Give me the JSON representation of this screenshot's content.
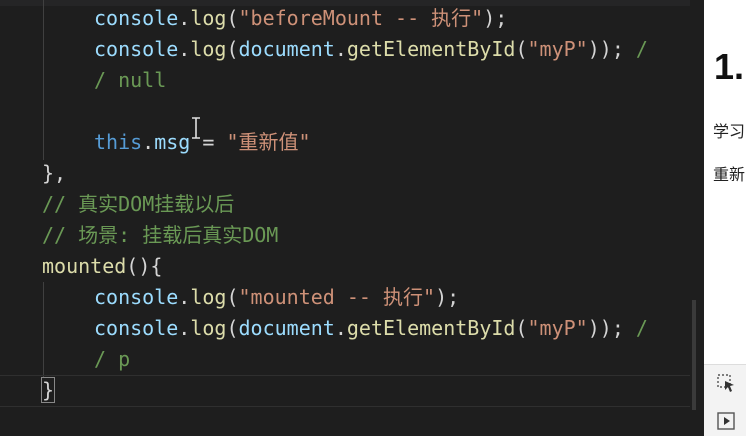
{
  "editor": {
    "lines": [
      {
        "indent": "    ",
        "tokens": [
          {
            "t": "console",
            "c": "var"
          },
          {
            "t": ".",
            "c": "brace"
          },
          {
            "t": "log",
            "c": "fn"
          },
          {
            "t": "(",
            "c": "brace"
          },
          {
            "t": "\"beforeMount -- 执行\"",
            "c": "str"
          },
          {
            "t": ");",
            "c": "brace"
          }
        ]
      },
      {
        "indent": "    ",
        "tokens": [
          {
            "t": "console",
            "c": "var"
          },
          {
            "t": ".",
            "c": "brace"
          },
          {
            "t": "log",
            "c": "fn"
          },
          {
            "t": "(",
            "c": "brace"
          },
          {
            "t": "document",
            "c": "var"
          },
          {
            "t": ".",
            "c": "brace"
          },
          {
            "t": "getElementById",
            "c": "fn"
          },
          {
            "t": "(",
            "c": "brace"
          },
          {
            "t": "\"myP\"",
            "c": "str"
          },
          {
            "t": ")); ",
            "c": "brace"
          },
          {
            "t": "/",
            "c": "cmt"
          }
        ]
      },
      {
        "indent": "    ",
        "tokens": [
          {
            "t": "/ null",
            "c": "cmt"
          }
        ]
      },
      {
        "indent": "",
        "tokens": []
      },
      {
        "indent": "    ",
        "tokens": [
          {
            "t": "this",
            "c": "kw"
          },
          {
            "t": ".",
            "c": "brace"
          },
          {
            "t": "msg",
            "c": "var"
          },
          {
            "t": " = ",
            "c": "brace"
          },
          {
            "t": "\"重新值\"",
            "c": "str"
          }
        ]
      },
      {
        "indent": "",
        "tokens": [
          {
            "t": "},",
            "c": "brace"
          }
        ]
      },
      {
        "indent": "",
        "tokens": [
          {
            "t": "// 真实DOM挂载以后",
            "c": "cmt"
          }
        ]
      },
      {
        "indent": "",
        "tokens": [
          {
            "t": "// 场景: 挂载后真实DOM",
            "c": "cmt"
          }
        ]
      },
      {
        "indent": "",
        "tokens": [
          {
            "t": "mounted",
            "c": "fn"
          },
          {
            "t": "()",
            "c": "brace"
          },
          {
            "t": "{",
            "c": "brace"
          }
        ]
      },
      {
        "indent": "    ",
        "tokens": [
          {
            "t": "console",
            "c": "var"
          },
          {
            "t": ".",
            "c": "brace"
          },
          {
            "t": "log",
            "c": "fn"
          },
          {
            "t": "(",
            "c": "brace"
          },
          {
            "t": "\"mounted -- 执行\"",
            "c": "str"
          },
          {
            "t": ");",
            "c": "brace"
          }
        ]
      },
      {
        "indent": "    ",
        "tokens": [
          {
            "t": "console",
            "c": "var"
          },
          {
            "t": ".",
            "c": "brace"
          },
          {
            "t": "log",
            "c": "fn"
          },
          {
            "t": "(",
            "c": "brace"
          },
          {
            "t": "document",
            "c": "var"
          },
          {
            "t": ".",
            "c": "brace"
          },
          {
            "t": "getElementById",
            "c": "fn"
          },
          {
            "t": "(",
            "c": "brace"
          },
          {
            "t": "\"myP\"",
            "c": "str"
          },
          {
            "t": ")); ",
            "c": "brace"
          },
          {
            "t": "/",
            "c": "cmt"
          }
        ]
      },
      {
        "indent": "    ",
        "tokens": [
          {
            "t": "/ p",
            "c": "cmt"
          }
        ]
      },
      {
        "indent": "",
        "tokens": [
          {
            "t": "}",
            "c": "brace"
          }
        ]
      }
    ]
  },
  "preview": {
    "heading": "1.",
    "text_1": "学习",
    "text_2": "重新"
  },
  "icons": {
    "cursor": "mouse-ibeam-icon",
    "select": "select-element-icon",
    "play": "play-icon"
  }
}
